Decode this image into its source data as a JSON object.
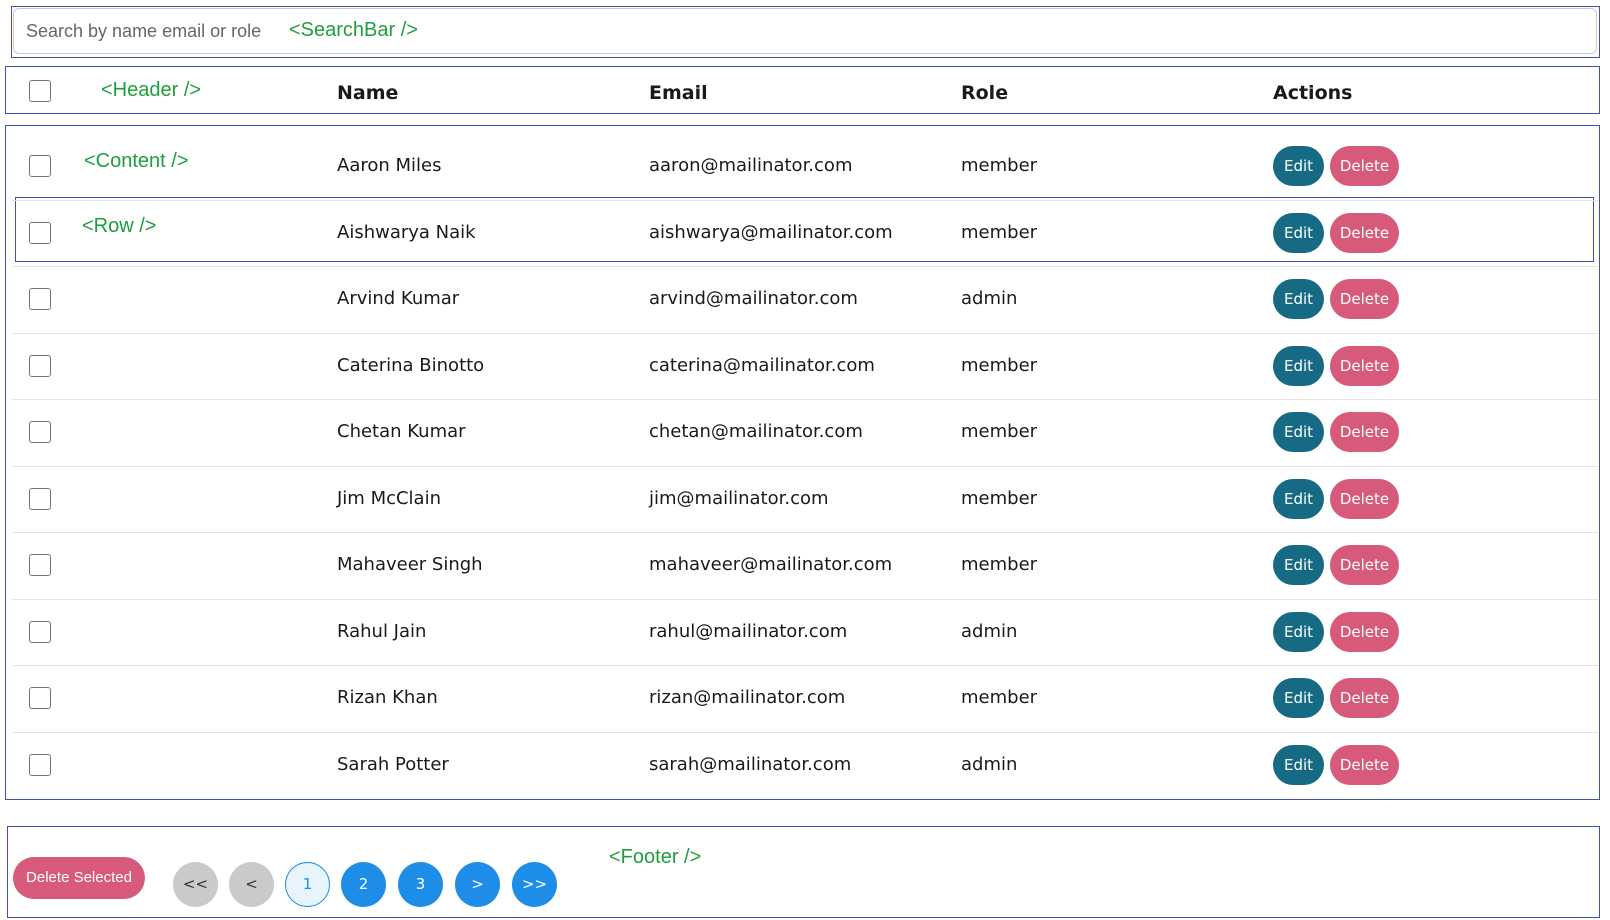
{
  "annotations": {
    "searchbar": "<SearchBar />",
    "header": "<Header />",
    "content": "<Content />",
    "row": "<Row />",
    "footer": "<Footer />"
  },
  "search": {
    "placeholder": "Search by name email or role",
    "value": ""
  },
  "header": {
    "name": "Name",
    "email": "Email",
    "role": "Role",
    "actions": "Actions"
  },
  "rows": [
    {
      "name": "Aaron Miles",
      "email": "aaron@mailinator.com",
      "role": "member"
    },
    {
      "name": "Aishwarya Naik",
      "email": "aishwarya@mailinator.com",
      "role": "member"
    },
    {
      "name": "Arvind Kumar",
      "email": "arvind@mailinator.com",
      "role": "admin"
    },
    {
      "name": "Caterina Binotto",
      "email": "caterina@mailinator.com",
      "role": "member"
    },
    {
      "name": "Chetan Kumar",
      "email": "chetan@mailinator.com",
      "role": "member"
    },
    {
      "name": "Jim McClain",
      "email": "jim@mailinator.com",
      "role": "member"
    },
    {
      "name": "Mahaveer Singh",
      "email": "mahaveer@mailinator.com",
      "role": "member"
    },
    {
      "name": "Rahul Jain",
      "email": "rahul@mailinator.com",
      "role": "admin"
    },
    {
      "name": "Rizan Khan",
      "email": "rizan@mailinator.com",
      "role": "member"
    },
    {
      "name": "Sarah Potter",
      "email": "sarah@mailinator.com",
      "role": "admin"
    }
  ],
  "actions": {
    "edit": "Edit",
    "delete": "Delete"
  },
  "footer": {
    "delete_selected": "Delete Selected",
    "pagination": {
      "first": "<<",
      "prev": "<",
      "pages": [
        "1",
        "2",
        "3"
      ],
      "current_page": "1",
      "next": ">",
      "last": ">>"
    }
  },
  "colors": {
    "frame": "#3f4fb8",
    "annotation": "#1f9e3d",
    "edit_button": "#176a84",
    "delete_button": "#d85a7a",
    "page_button": "#1e8de8",
    "page_button_disabled": "#c8cacc"
  }
}
